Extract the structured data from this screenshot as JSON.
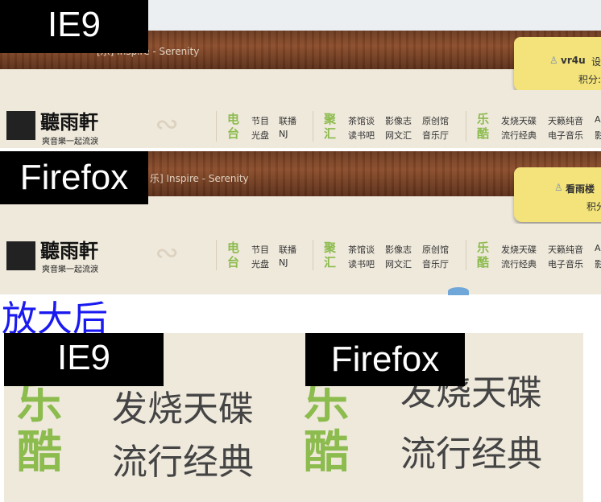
{
  "labels": {
    "ie9": "IE9",
    "firefox": "Firefox",
    "zoom_title": "放大后"
  },
  "breadcrumb_ie9": "[乐] Inspire - Serenity",
  "breadcrumb_ff": "乐] Inspire - Serenity",
  "user_ie9": {
    "name": "vr4u",
    "setting": "设",
    "points": "积分:"
  },
  "user_ff": {
    "name": "看雨楼",
    "points": "积分"
  },
  "logo": {
    "name": "聽雨軒",
    "slogan": "爽音樂一起流淚"
  },
  "nav": [
    {
      "cat": [
        "电",
        "台"
      ],
      "color": "#8cbb4e",
      "links": [
        [
          "节目",
          "联播"
        ],
        [
          "光盘",
          "NJ"
        ]
      ]
    },
    {
      "cat": [
        "聚",
        "汇"
      ],
      "color": "#8cbb4e",
      "links": [
        [
          "茶馆谈",
          "影像志",
          "原创馆"
        ],
        [
          "读书吧",
          "网文汇",
          "音乐厅"
        ]
      ]
    },
    {
      "cat": [
        "乐",
        "酷"
      ],
      "color": "#8cbb4e",
      "links": [
        [
          "发烧天碟",
          "天籁纯音",
          "A"
        ],
        [
          "流行经典",
          "电子音乐",
          "影"
        ]
      ]
    }
  ],
  "zoom": {
    "cat": [
      "乐",
      "酷"
    ],
    "links": [
      "发烧天碟",
      "流行经典"
    ]
  },
  "colors": {
    "accent_green": "#8cbb4e",
    "zoom_title_blue": "#1a1af0",
    "wood": "#6b3a20",
    "note_yellow": "#f3e37a"
  }
}
